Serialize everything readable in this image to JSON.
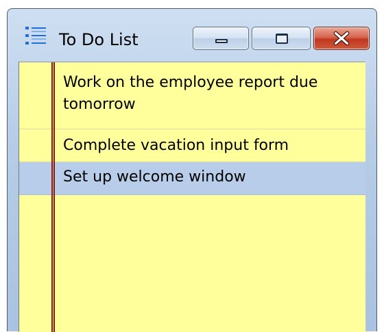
{
  "window": {
    "title": "To Do List",
    "icon": "list-icon",
    "controls": [
      "minimize-icon",
      "maximize-icon",
      "close-icon"
    ]
  },
  "colors": {
    "note_background": "#ffff9c",
    "margin_line": "#8b1a0a",
    "selected_row": "#b7cde9",
    "close_button": "#c0381f"
  },
  "tasks": [
    {
      "text": "Work on the employee report due tomorrow",
      "selected": false
    },
    {
      "text": "Complete vacation input form",
      "selected": false
    },
    {
      "text": "Set up welcome window",
      "selected": true
    }
  ]
}
